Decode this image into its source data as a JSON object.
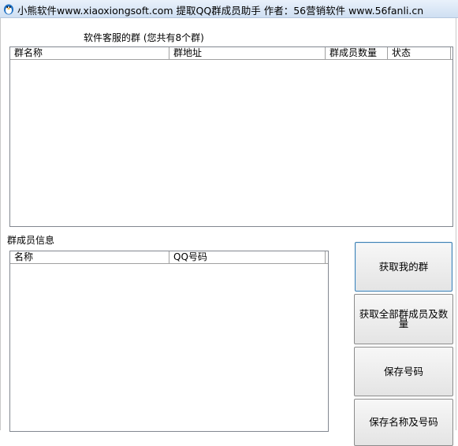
{
  "window": {
    "title": "小熊软件www.xiaoxiongsoft.com 提取QQ群成员助手 作者：56营销软件  www.56fanli.cn"
  },
  "groups_section": {
    "label": "软件客服的群 (您共有8个群)",
    "columns": [
      "群名称",
      "群地址",
      "群成员数量",
      "状态"
    ]
  },
  "members_section": {
    "label": "群成员信息",
    "columns": [
      "名称",
      "QQ号码"
    ]
  },
  "buttons": {
    "get_my_groups": "获取我的群",
    "get_all_members": "获取全部群成员及数量",
    "save_numbers": "保存号码",
    "save_names_numbers": "保存名称及号码"
  },
  "colors": {
    "titlebar": "#cfdff2",
    "button_focus_border": "#3c7fb1"
  },
  "icons": {
    "app": "penguin-icon"
  }
}
